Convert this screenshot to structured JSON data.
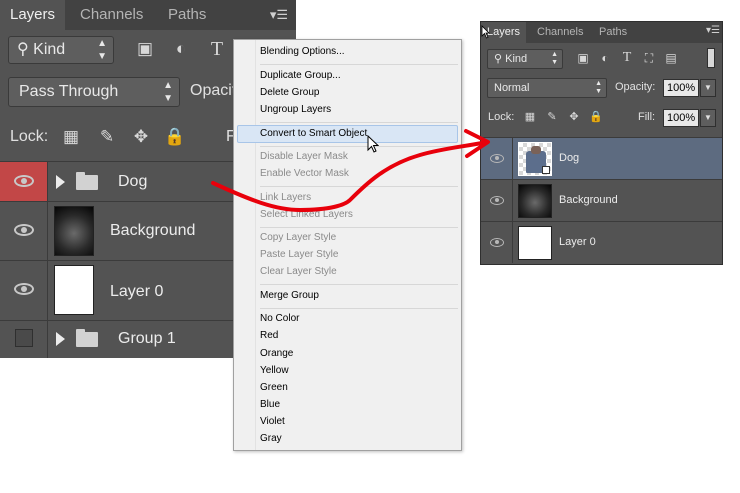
{
  "left_panel": {
    "tabs": [
      {
        "label": "Layers",
        "active": true
      },
      {
        "label": "Channels",
        "active": false
      },
      {
        "label": "Paths",
        "active": false
      }
    ],
    "menu_icon": "panel-menu-icon",
    "filter": {
      "kind_label": "Kind",
      "icons": [
        "image-filter-icon",
        "adjustment-filter-icon",
        "type-filter-icon",
        "shape-filter-icon"
      ]
    },
    "blend_mode": "Pass Through",
    "opacity_label": "Opacit",
    "lock_label": "Lock:",
    "lock_icons": [
      "lock-transparent-icon",
      "lock-paint-icon",
      "lock-move-icon",
      "lock-all-icon"
    ],
    "fill_label": "F",
    "layers": [
      {
        "name": "Dog",
        "type": "group",
        "visible": true,
        "highlight_color": "#c24747"
      },
      {
        "name": "Background",
        "type": "gradient",
        "visible": true
      },
      {
        "name": "Layer 0",
        "type": "white",
        "visible": true
      },
      {
        "name": "Group 1",
        "type": "group",
        "visible": false
      }
    ]
  },
  "context_menu": {
    "items": [
      {
        "label": "Blending Options...",
        "enabled": true
      },
      {
        "label": "Duplicate Group...",
        "enabled": true
      },
      {
        "label": "Delete Group",
        "enabled": true
      },
      {
        "label": "Ungroup Layers",
        "enabled": true
      },
      {
        "label": "Convert to Smart Object",
        "enabled": true,
        "highlighted": true
      },
      {
        "label": "Disable Layer Mask",
        "enabled": false
      },
      {
        "label": "Enable Vector Mask",
        "enabled": false
      },
      {
        "label": "Link Layers",
        "enabled": false
      },
      {
        "label": "Select Linked Layers",
        "enabled": false
      },
      {
        "label": "Copy Layer Style",
        "enabled": false
      },
      {
        "label": "Paste Layer Style",
        "enabled": false
      },
      {
        "label": "Clear Layer Style",
        "enabled": false
      },
      {
        "label": "Merge Group",
        "enabled": true
      },
      {
        "label": "No Color",
        "enabled": true
      },
      {
        "label": "Red",
        "enabled": true
      },
      {
        "label": "Orange",
        "enabled": true
      },
      {
        "label": "Yellow",
        "enabled": true
      },
      {
        "label": "Green",
        "enabled": true
      },
      {
        "label": "Blue",
        "enabled": true
      },
      {
        "label": "Violet",
        "enabled": true
      },
      {
        "label": "Gray",
        "enabled": true
      }
    ],
    "highlight_color": "#d9e6f5"
  },
  "right_panel": {
    "tabs": [
      {
        "label": "Layers",
        "active": true
      },
      {
        "label": "Channels",
        "active": false
      },
      {
        "label": "Paths",
        "active": false
      }
    ],
    "filter_kind_label": "Kind",
    "blend_mode": "Normal",
    "opacity_label": "Opacity:",
    "opacity_value": "100%",
    "lock_label": "Lock:",
    "fill_label": "Fill:",
    "fill_value": "100%",
    "layers": [
      {
        "name": "Dog",
        "type": "smart-object",
        "selected": true
      },
      {
        "name": "Background",
        "type": "gradient",
        "selected": false
      },
      {
        "name": "Layer 0",
        "type": "white",
        "selected": false
      }
    ],
    "selected_row_color": "#5d6b80"
  },
  "annotation_arrow": {
    "color": "#e8000b"
  }
}
